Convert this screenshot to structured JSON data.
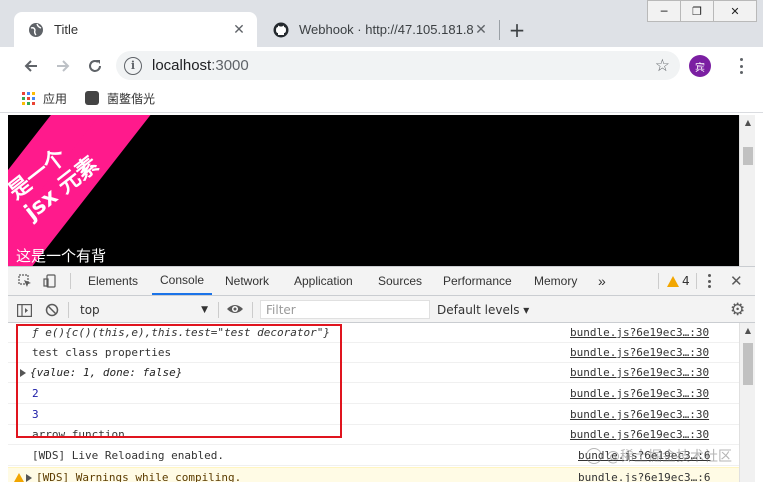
{
  "browser": {
    "tabs": [
      {
        "title": "Title",
        "icon": "globe-icon",
        "active": true
      },
      {
        "title": "Webhook · http://47.105.181.8",
        "icon": "github-icon",
        "active": false
      }
    ],
    "window_buttons": [
      "─",
      "❐",
      "✕"
    ],
    "url": {
      "host": "localhost",
      "port": ":3000"
    },
    "avatar_text": "宾",
    "bookmarks": [
      {
        "label": "应用",
        "icon": "apps-grid-icon"
      },
      {
        "label": "菌鳖偕光",
        "icon": "bookmark-favicon"
      }
    ]
  },
  "page": {
    "art_text_line1": "是一个",
    "art_text_line2": "jsx 元素",
    "caption": "这是一个有背",
    "accent": "#ff1a8c"
  },
  "devtools": {
    "tabs": [
      "Elements",
      "Console",
      "Network",
      "Application",
      "Sources",
      "Performance",
      "Memory"
    ],
    "active_tab": "Console",
    "more_tabs": "»",
    "warning_count": "4",
    "context": "top",
    "filter_placeholder": "Filter",
    "levels": "Default levels ▾",
    "console_rows": [
      {
        "text": "ƒ e(){c()(this,e),this.test=\"test decorator\"}",
        "src": "bundle.js?6e19ec3…:30",
        "style": "fn"
      },
      {
        "text": "test class properties",
        "src": "bundle.js?6e19ec3…:30",
        "style": "plain"
      },
      {
        "text": "{value: 1, done: false}",
        "src": "bundle.js?6e19ec3…:30",
        "style": "obj"
      },
      {
        "text": "2",
        "src": "bundle.js?6e19ec3…:30",
        "style": "num"
      },
      {
        "text": "3",
        "src": "bundle.js?6e19ec3…:30",
        "style": "num"
      },
      {
        "text": "arrow function",
        "src": "bundle.js?6e19ec3…:30",
        "style": "plain"
      },
      {
        "text": "[WDS] Live Reloading enabled.",
        "src": "bundle.js?6e19ec3…:6",
        "style": "plain"
      },
      {
        "text": "[WDS] Warnings while compiling.",
        "src": "bundle.js?6e19ec3…:6",
        "style": "warn"
      }
    ]
  },
  "watermark": "@稀土掘金技术社区"
}
